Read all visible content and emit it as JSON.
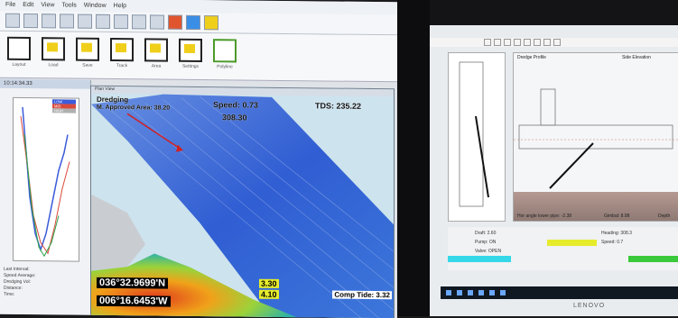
{
  "left_app": {
    "menu": [
      "File",
      "Edit",
      "View",
      "Tools",
      "Window",
      "Help"
    ],
    "ribbon_labels": [
      "Layout",
      "Load",
      "Save",
      "Track",
      "Area",
      "Settings",
      "Polyline"
    ],
    "mini_pane": {
      "title": "10:14:34.33",
      "legend": [
        {
          "label": "LOW",
          "color": "#3b5bd9"
        },
        {
          "label": "MID",
          "color": "#d94a3b"
        },
        {
          "label": "HIGH",
          "color": "#b0b0b0"
        }
      ],
      "info_lines": [
        "Last Interval:",
        "Speed Average:",
        "Dredging Vol:",
        "Distance:",
        "Time:"
      ]
    },
    "map": {
      "window_title": "Plan View",
      "mode": "Dredging",
      "approved_area": "M. Approved Area: 38.20",
      "speed": "Speed: 0.73",
      "heading": "308.30",
      "tds": "TDS: 235.22",
      "latitude": "036°32.9699'N",
      "longitude": "006°16.6453'W",
      "depth_a": "3.30",
      "depth_b": "4.10",
      "comp_tide": "Comp Tide: 3.32"
    }
  },
  "right_app": {
    "profile_title": "Dredge Profile",
    "section_title": "Side Elevation",
    "bottom_caption": "Hor angle lower pipe: -2.38",
    "gimbal": "Gimbal: 8.98",
    "depth_label": "Depth",
    "status_values": [
      "Draft: 2.60",
      "Pump: ON",
      "Valve: OPEN",
      "Heading: 308.3",
      "Speed: 0.7"
    ]
  },
  "colors": {
    "map_water": "#cde3ee",
    "swath_deep": "#1f4fd0",
    "shoal_red": "#e03a1c",
    "highlight_yellow": "#e6ec2b",
    "status_cyan": "#35d8e8",
    "status_green": "#39c93a"
  },
  "brand": "LENOVO"
}
